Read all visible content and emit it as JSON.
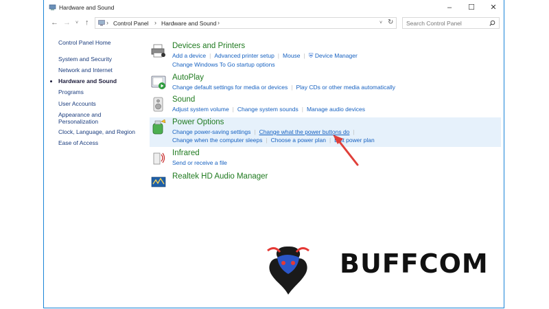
{
  "window": {
    "title": "Hardware and Sound"
  },
  "address": {
    "crumbs": [
      "Control Panel",
      "Hardware and Sound"
    ],
    "search_placeholder": "Search Control Panel"
  },
  "sidebar": {
    "items": [
      {
        "label": "Control Panel Home"
      },
      {
        "label": "System and Security"
      },
      {
        "label": "Network and Internet"
      },
      {
        "label": "Hardware and Sound",
        "active": true
      },
      {
        "label": "Programs"
      },
      {
        "label": "User Accounts"
      },
      {
        "label": "Appearance and"
      },
      {
        "label": "Personalization"
      },
      {
        "label": "Clock, Language, and Region"
      },
      {
        "label": "Ease of Access"
      }
    ]
  },
  "categories": {
    "devices": {
      "title": "Devices and Printers",
      "row1": [
        "Add a device",
        "Advanced printer setup",
        "Mouse",
        "Device Manager"
      ],
      "row2": [
        "Change Windows To Go startup options"
      ]
    },
    "autoplay": {
      "title": "AutoPlay",
      "row1": [
        "Change default settings for media or devices",
        "Play CDs or other media automatically"
      ]
    },
    "sound": {
      "title": "Sound",
      "row1": [
        "Adjust system volume",
        "Change system sounds",
        "Manage audio devices"
      ]
    },
    "power": {
      "title": "Power Options",
      "row1": [
        "Change power-saving settings",
        "Change what the power buttons do"
      ],
      "row2": [
        "Change when the computer sleeps",
        "Choose a power plan",
        "Edit power plan"
      ]
    },
    "infrared": {
      "title": "Infrared",
      "row1": [
        "Send or receive a file"
      ]
    },
    "realtek": {
      "title": "Realtek HD Audio Manager"
    }
  },
  "watermark": {
    "text": "BUFFCOM"
  },
  "colors": {
    "accent": "#1883d7",
    "link": "#1560c0",
    "title_green": "#1f7a1f",
    "highlight": "#e6f1fb",
    "arrow": "#e0403a"
  }
}
